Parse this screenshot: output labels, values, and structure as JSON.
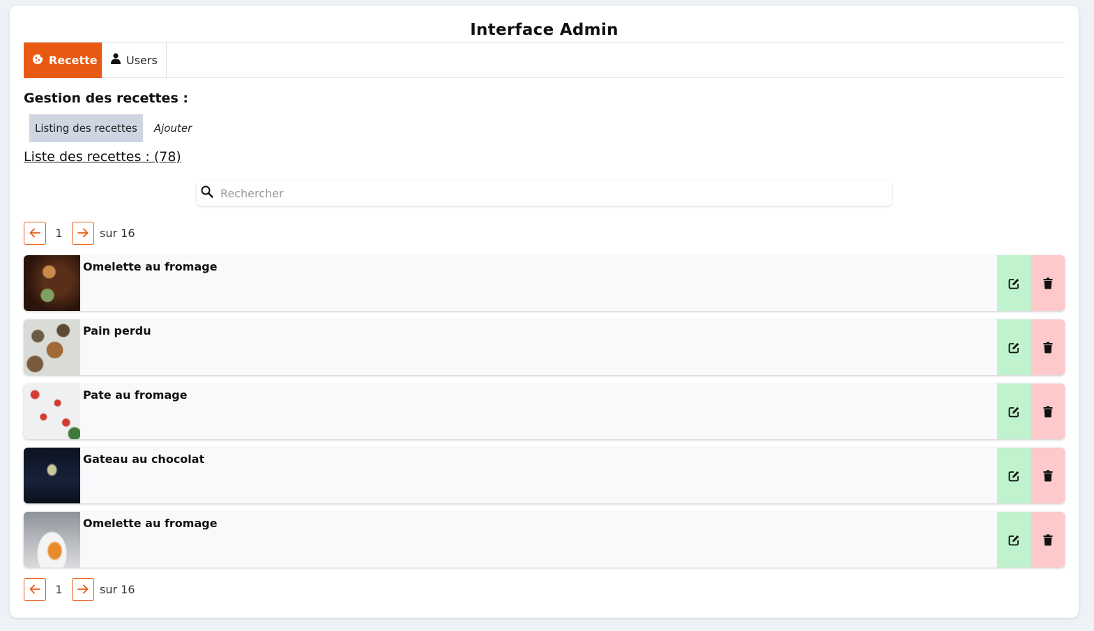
{
  "app": {
    "title": "Interface Admin"
  },
  "tabs": [
    {
      "label": "Recette",
      "icon": "cookie-icon",
      "active": true
    },
    {
      "label": "Users",
      "icon": "user-icon",
      "active": false
    }
  ],
  "section": {
    "title": "Gestion des recettes :"
  },
  "subtabs": {
    "listing": "Listing des recettes",
    "add": "Ajouter"
  },
  "list": {
    "heading": "Liste des recettes : (78)"
  },
  "search": {
    "placeholder": "Rechercher",
    "value": ""
  },
  "pagination": {
    "current": "1",
    "total_label": "sur 16"
  },
  "recipes": [
    {
      "name": "Omelette au fromage"
    },
    {
      "name": "Pain perdu"
    },
    {
      "name": "Pate au fromage"
    },
    {
      "name": "Gateau au chocolat"
    },
    {
      "name": "Omelette au fromage"
    }
  ],
  "colors": {
    "accent": "#e85a12",
    "edit_bg": "#bff2cd",
    "delete_bg": "#fdc9cb",
    "subtab_active": "#cfd6e2"
  }
}
